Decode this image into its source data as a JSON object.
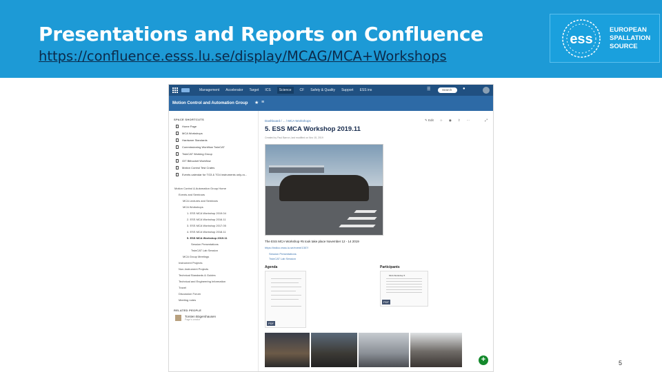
{
  "slide": {
    "title": "Presentations and Reports on Confluence",
    "url": "https://confluence.esss.lu.se/display/MCAG/MCA+Workshops",
    "logo": {
      "line1": "EUROPEAN",
      "line2": "SPALLATION",
      "line3": "SOURCE"
    },
    "page_number": "5"
  },
  "confluence": {
    "nav": [
      "Management",
      "Accelerator",
      "Target",
      "ICS",
      "Science",
      "CF",
      "Safety & Quality",
      "Support",
      "ESS ins"
    ],
    "active_nav": "Science",
    "search_placeholder": "Search",
    "space_title": "Motion Control and Automation Group",
    "sidebar": {
      "shortcuts_heading": "SPACE SHORTCUTS",
      "shortcuts": [
        "Home Page",
        "MCA Workshops",
        "Hardware Standards",
        "Commissioning Workflow TwinCAT",
        "TwinCAT Working Group",
        "GIT Bitbucket Workflow",
        "Motion Control Test Crates",
        "Events calendar for TG3 & TG4 instruments only-ro..."
      ],
      "tree": [
        "Motion Control & Automation Group Home",
        "Events and Seminars",
        "MCA Lectures and Seminars",
        "MCA Workshops",
        "1. ESS MCA Workshop 2019.04",
        "2. ESS MCA Workshop 2016.11",
        "3. ESS MCA Workshop 2017.05",
        "4. ESS MCA Workshop 2018.11",
        "5. ESS MCA Workshop 2019.11",
        "Session Presentations",
        "TwinCAT Lab Session",
        "MCA Group Meetings",
        "Instrument Projects",
        "Non-Instrument Projects",
        "Technical Standards & Guides",
        "Technical and Engineering Information",
        "Travel",
        "Discussion Forum",
        "Meeting notes"
      ],
      "related_heading": "RELATED PEOPLE",
      "person_name": "Torsten Bögershausen",
      "person_sub": "Page's creator"
    },
    "page": {
      "breadcrumb": "Dashboard / ... / MCA Workshops",
      "title": "5. ESS MCA Workshop 2019.11",
      "byline": "Created by Paul Barron, last modified on Nov 15, 2019",
      "toolbar_edit": "Edit",
      "description": "The ESS MCA Workshop #5 took take place November 12 - 14 2019",
      "link": "https://indico.esss.lu.se/event/1307/",
      "bullets": [
        "Session Presentations",
        "TwinCAT Lab Session"
      ],
      "agenda_label": "Agenda",
      "participants_label": "Participants",
      "pdf_badge": "PDF",
      "participants_doc_title": "MCA Workshop 5"
    },
    "add_button": "+"
  },
  "colors": {
    "slide_blue": "#1d9ad6",
    "confluence_nav": "#205081",
    "space_header": "#2d6aa6",
    "link": "#3b73af"
  }
}
